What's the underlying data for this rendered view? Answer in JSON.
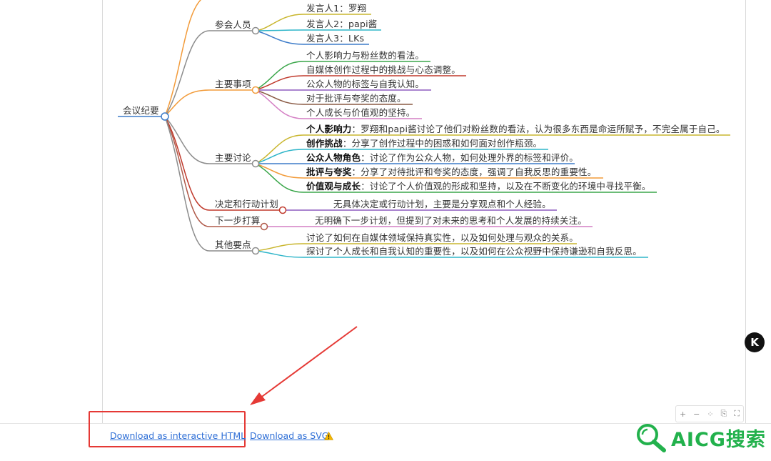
{
  "mindmap": {
    "root": "会议纪要",
    "branches": {
      "attendees": {
        "label": "参会人员",
        "items": [
          "发言人1：罗翔",
          "发言人2：papi酱",
          "发言人3：LKs"
        ]
      },
      "main_items": {
        "label": "主要事项",
        "items": [
          "个人影响力与粉丝数的看法。",
          "自媒体创作过程中的挑战与心态调整。",
          "公众人物的标签与自我认知。",
          "对于批评与夸奖的态度。",
          "个人成长与价值观的坚持。"
        ]
      },
      "discussion": {
        "label": "主要讨论",
        "items": [
          {
            "title": "个人影响力",
            "text": "：罗翔和papi酱讨论了他们对粉丝数的看法，认为很多东西是命运所赋予，不完全属于自己。"
          },
          {
            "title": "创作挑战",
            "text": "：分享了创作过程中的困惑和如何面对创作瓶颈。"
          },
          {
            "title": "公众人物角色",
            "text": "：讨论了作为公众人物，如何处理外界的标签和评价。"
          },
          {
            "title": "批评与夸奖",
            "text": "：分享了对待批评和夸奖的态度，强调了自我反思的重要性。"
          },
          {
            "title": "价值观与成长",
            "text": "：讨论了个人价值观的形成和坚持，以及在不断变化的环境中寻找平衡。"
          }
        ]
      },
      "decision": {
        "label": "决定和行动计划",
        "text": "无具体决定或行动计划，主要是分享观点和个人经验。"
      },
      "next": {
        "label": "下一步打算",
        "text": "无明确下一步计划，但提到了对未来的思考和个人发展的持续关注。"
      },
      "others": {
        "label": "其他要点",
        "items": [
          "讨论了如何在自媒体领域保持真实性，以及如何处理与观众的关系。",
          "探讨了个人成长和自我认知的重要性，以及如何在公众视野中保持谦逊和自我反思。"
        ]
      }
    }
  },
  "toolbar": {
    "zoom_in": "+",
    "zoom_out": "−",
    "fit": "⁘",
    "export": "⎘",
    "fullscreen": "⛶"
  },
  "footer": {
    "download_html": "Download as interactive HTML",
    "download_svg": "Download as SVG"
  },
  "badge_label": "K",
  "watermark_text": "AICG搜索",
  "colors": {
    "accent_link": "#2f6fd6",
    "annotation_red": "#e53935",
    "watermark_green": "#22b14c"
  }
}
